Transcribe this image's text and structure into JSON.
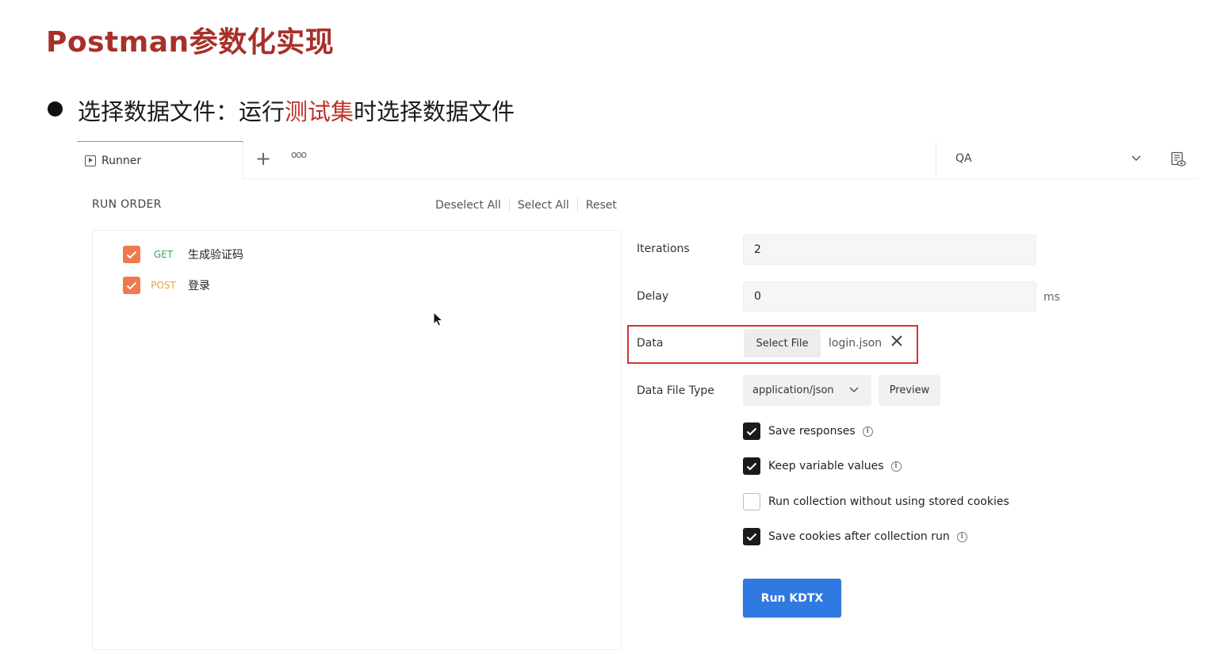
{
  "slide": {
    "title": "Postman参数化实现",
    "bullet_prefix": "选择数据文件：运行",
    "bullet_highlight": "测试集",
    "bullet_suffix": "时选择数据文件"
  },
  "tabs": {
    "active_label": "Runner",
    "add_symbol": "+",
    "more_symbol": "ooo",
    "environment": "QA"
  },
  "run_order": {
    "title": "RUN ORDER",
    "deselect_all": "Deselect All",
    "select_all": "Select All",
    "reset": "Reset",
    "requests": [
      {
        "method": "GET",
        "name": "生成验证码",
        "checked": true
      },
      {
        "method": "POST",
        "name": "登录",
        "checked": true
      }
    ]
  },
  "settings": {
    "iterations_label": "Iterations",
    "iterations_value": "2",
    "delay_label": "Delay",
    "delay_value": "0",
    "delay_unit": "ms",
    "data_label": "Data",
    "select_file_label": "Select File",
    "file_name": "login.json",
    "data_file_type_label": "Data File Type",
    "data_file_type_value": "application/json",
    "preview_label": "Preview",
    "options": [
      {
        "label": "Save responses",
        "checked": true,
        "info": true
      },
      {
        "label": "Keep variable values",
        "checked": true,
        "info": true
      },
      {
        "label": "Run collection without using stored cookies",
        "checked": false,
        "info": false
      },
      {
        "label": "Save cookies after collection run",
        "checked": true,
        "info": true
      }
    ],
    "run_button_label": "Run KDTX"
  },
  "colors": {
    "title_red": "#a8302a",
    "tab_accent": "#e07b39",
    "checkbox_orange": "#ef7a4e",
    "get_green": "#3aa55a",
    "post_orange": "#e8a33b",
    "highlight_red": "#d63333",
    "run_blue": "#2f79e0"
  }
}
